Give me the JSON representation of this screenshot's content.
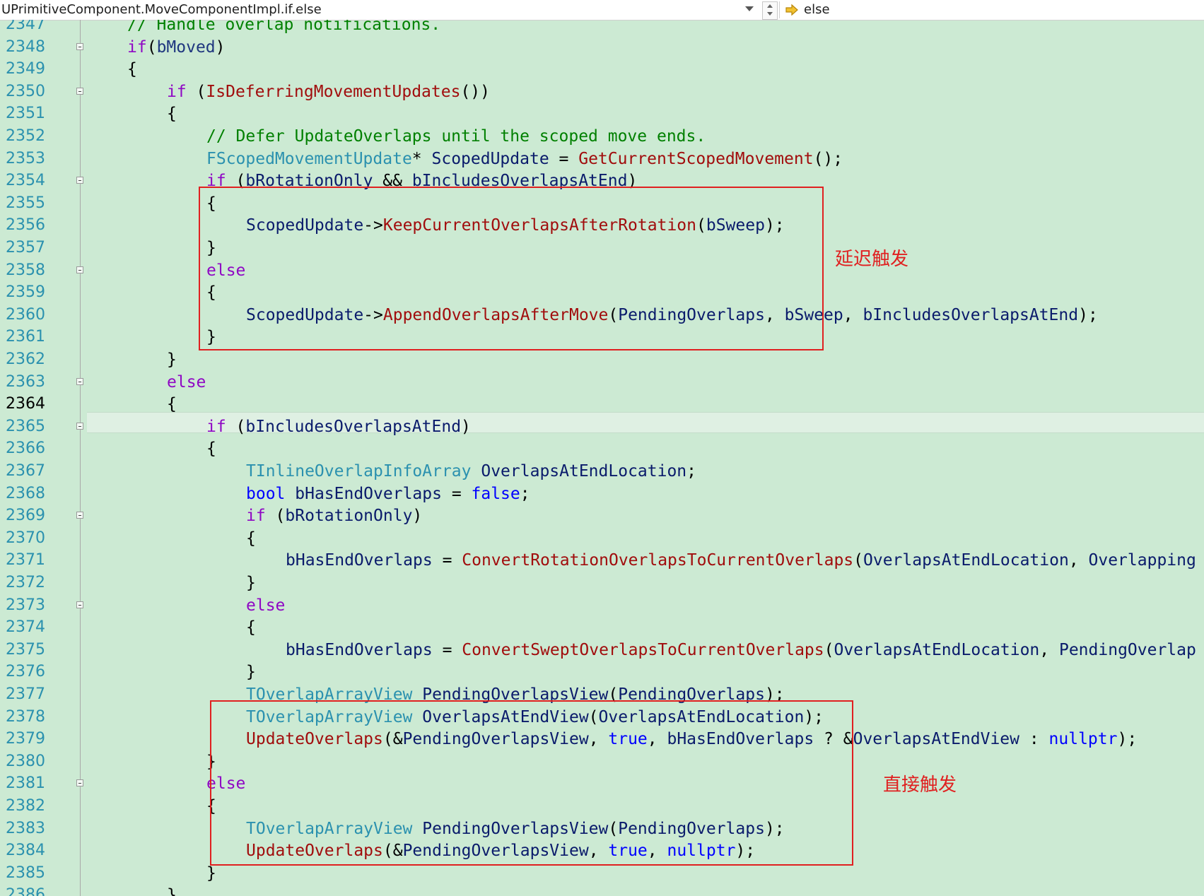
{
  "navbar": {
    "scope": "UPrimitiveComponent.MoveComponentImpl.if.else",
    "member": "else"
  },
  "annotations": {
    "deferred": "延迟触发",
    "direct": "直接触发"
  },
  "lines": [
    {
      "n": "2347",
      "fold": false,
      "indent": 1,
      "tokens": [
        [
          "cm",
          "// Handle overlap notifications."
        ]
      ]
    },
    {
      "n": "2348",
      "fold": true,
      "indent": 1,
      "tokens": [
        [
          "k",
          "if"
        ],
        [
          "",
          "("
        ],
        [
          "v",
          "bMoved"
        ],
        [
          "",
          ")"
        ]
      ]
    },
    {
      "n": "2349",
      "fold": false,
      "indent": 1,
      "tokens": [
        [
          "",
          "{"
        ]
      ]
    },
    {
      "n": "2350",
      "fold": true,
      "indent": 2,
      "tokens": [
        [
          "k",
          "if"
        ],
        [
          "",
          " ("
        ],
        [
          "fc",
          "IsDeferringMovementUpdates"
        ],
        [
          "",
          "())"
        ]
      ]
    },
    {
      "n": "2351",
      "fold": false,
      "indent": 2,
      "tokens": [
        [
          "",
          "{"
        ]
      ]
    },
    {
      "n": "2352",
      "fold": false,
      "indent": 3,
      "tokens": [
        [
          "cm",
          "// Defer UpdateOverlaps until the scoped move ends."
        ]
      ]
    },
    {
      "n": "2353",
      "fold": false,
      "indent": 3,
      "tokens": [
        [
          "t",
          "FScopedMovementUpdate"
        ],
        [
          "",
          "* "
        ],
        [
          "v2",
          "ScopedUpdate"
        ],
        [
          "",
          " = "
        ],
        [
          "fc",
          "GetCurrentScopedMovement"
        ],
        [
          "",
          "();"
        ]
      ]
    },
    {
      "n": "2354",
      "fold": true,
      "indent": 3,
      "tokens": [
        [
          "k",
          "if"
        ],
        [
          "",
          " ("
        ],
        [
          "v2",
          "bRotationOnly"
        ],
        [
          "",
          " && "
        ],
        [
          "v2",
          "bIncludesOverlapsAtEnd"
        ],
        [
          "",
          ")"
        ]
      ]
    },
    {
      "n": "2355",
      "fold": false,
      "indent": 3,
      "tokens": [
        [
          "",
          "{"
        ]
      ]
    },
    {
      "n": "2356",
      "fold": false,
      "indent": 4,
      "tokens": [
        [
          "v2",
          "ScopedUpdate"
        ],
        [
          "",
          "->"
        ],
        [
          "fc",
          "KeepCurrentOverlapsAfterRotation"
        ],
        [
          "",
          "("
        ],
        [
          "v2",
          "bSweep"
        ],
        [
          "",
          ");"
        ]
      ]
    },
    {
      "n": "2357",
      "fold": false,
      "indent": 3,
      "tokens": [
        [
          "",
          "}"
        ]
      ]
    },
    {
      "n": "2358",
      "fold": true,
      "indent": 3,
      "tokens": [
        [
          "k",
          "else"
        ]
      ]
    },
    {
      "n": "2359",
      "fold": false,
      "indent": 3,
      "tokens": [
        [
          "",
          "{"
        ]
      ]
    },
    {
      "n": "2360",
      "fold": false,
      "indent": 4,
      "tokens": [
        [
          "v2",
          "ScopedUpdate"
        ],
        [
          "",
          "->"
        ],
        [
          "fc",
          "AppendOverlapsAfterMove"
        ],
        [
          "",
          "("
        ],
        [
          "v2",
          "PendingOverlaps"
        ],
        [
          "",
          ", "
        ],
        [
          "v2",
          "bSweep"
        ],
        [
          "",
          ", "
        ],
        [
          "v2",
          "bIncludesOverlapsAtEnd"
        ],
        [
          "",
          ");"
        ]
      ]
    },
    {
      "n": "2361",
      "fold": false,
      "indent": 3,
      "tokens": [
        [
          "",
          "}"
        ]
      ]
    },
    {
      "n": "2362",
      "fold": false,
      "indent": 2,
      "tokens": [
        [
          "",
          "}"
        ]
      ]
    },
    {
      "n": "2363",
      "fold": true,
      "indent": 2,
      "tokens": [
        [
          "k",
          "else"
        ]
      ]
    },
    {
      "n": "2364",
      "fold": false,
      "indent": 2,
      "current": true,
      "tokens": [
        [
          "",
          "{"
        ]
      ]
    },
    {
      "n": "2365",
      "fold": true,
      "indent": 3,
      "tokens": [
        [
          "k",
          "if"
        ],
        [
          "",
          " ("
        ],
        [
          "v2",
          "bIncludesOverlapsAtEnd"
        ],
        [
          "",
          ")"
        ]
      ]
    },
    {
      "n": "2366",
      "fold": false,
      "indent": 3,
      "tokens": [
        [
          "",
          "{"
        ]
      ]
    },
    {
      "n": "2367",
      "fold": false,
      "indent": 4,
      "tokens": [
        [
          "t",
          "TInlineOverlapInfoArray"
        ],
        [
          "",
          " "
        ],
        [
          "v2",
          "OverlapsAtEndLocation"
        ],
        [
          "",
          ";"
        ]
      ]
    },
    {
      "n": "2368",
      "fold": false,
      "indent": 4,
      "tokens": [
        [
          "b",
          "bool"
        ],
        [
          "",
          " "
        ],
        [
          "v2",
          "bHasEndOverlaps"
        ],
        [
          "",
          " = "
        ],
        [
          "b",
          "false"
        ],
        [
          "",
          ";"
        ]
      ]
    },
    {
      "n": "2369",
      "fold": true,
      "indent": 4,
      "tokens": [
        [
          "k",
          "if"
        ],
        [
          "",
          " ("
        ],
        [
          "v2",
          "bRotationOnly"
        ],
        [
          "",
          ")"
        ]
      ]
    },
    {
      "n": "2370",
      "fold": false,
      "indent": 4,
      "tokens": [
        [
          "",
          "{"
        ]
      ]
    },
    {
      "n": "2371",
      "fold": false,
      "indent": 5,
      "tokens": [
        [
          "v2",
          "bHasEndOverlaps"
        ],
        [
          "",
          " = "
        ],
        [
          "fc",
          "ConvertRotationOverlapsToCurrentOverlaps"
        ],
        [
          "",
          "("
        ],
        [
          "v2",
          "OverlapsAtEndLocation"
        ],
        [
          "",
          ", "
        ],
        [
          "v2",
          "Overlapping"
        ]
      ]
    },
    {
      "n": "2372",
      "fold": false,
      "indent": 4,
      "tokens": [
        [
          "",
          "}"
        ]
      ]
    },
    {
      "n": "2373",
      "fold": true,
      "indent": 4,
      "tokens": [
        [
          "k",
          "else"
        ]
      ]
    },
    {
      "n": "2374",
      "fold": false,
      "indent": 4,
      "tokens": [
        [
          "",
          "{"
        ]
      ]
    },
    {
      "n": "2375",
      "fold": false,
      "indent": 5,
      "tokens": [
        [
          "v2",
          "bHasEndOverlaps"
        ],
        [
          "",
          " = "
        ],
        [
          "fc",
          "ConvertSweptOverlapsToCurrentOverlaps"
        ],
        [
          "",
          "("
        ],
        [
          "v2",
          "OverlapsAtEndLocation"
        ],
        [
          "",
          ", "
        ],
        [
          "v2",
          "PendingOverlap"
        ]
      ]
    },
    {
      "n": "2376",
      "fold": false,
      "indent": 4,
      "tokens": [
        [
          "",
          "}"
        ]
      ]
    },
    {
      "n": "2377",
      "fold": false,
      "indent": 4,
      "tokens": [
        [
          "t",
          "TOverlapArrayView"
        ],
        [
          "",
          " "
        ],
        [
          "v2",
          "PendingOverlapsView"
        ],
        [
          "",
          "("
        ],
        [
          "v2",
          "PendingOverlaps"
        ],
        [
          "",
          ");"
        ]
      ]
    },
    {
      "n": "2378",
      "fold": false,
      "indent": 4,
      "tokens": [
        [
          "t",
          "TOverlapArrayView"
        ],
        [
          "",
          " "
        ],
        [
          "v2",
          "OverlapsAtEndView"
        ],
        [
          "",
          "("
        ],
        [
          "v2",
          "OverlapsAtEndLocation"
        ],
        [
          "",
          ");"
        ]
      ]
    },
    {
      "n": "2379",
      "fold": false,
      "indent": 4,
      "tokens": [
        [
          "fc",
          "UpdateOverlaps"
        ],
        [
          "",
          "(&"
        ],
        [
          "v2",
          "PendingOverlapsView"
        ],
        [
          "",
          ", "
        ],
        [
          "b",
          "true"
        ],
        [
          "",
          ", "
        ],
        [
          "v2",
          "bHasEndOverlaps"
        ],
        [
          "",
          " ? &"
        ],
        [
          "v2",
          "OverlapsAtEndView"
        ],
        [
          "",
          " : "
        ],
        [
          "b",
          "nullptr"
        ],
        [
          "",
          ");"
        ]
      ]
    },
    {
      "n": "2380",
      "fold": false,
      "indent": 3,
      "tokens": [
        [
          "",
          "}"
        ]
      ]
    },
    {
      "n": "2381",
      "fold": true,
      "indent": 3,
      "tokens": [
        [
          "k",
          "else"
        ]
      ]
    },
    {
      "n": "2382",
      "fold": false,
      "indent": 3,
      "tokens": [
        [
          "",
          "{"
        ]
      ]
    },
    {
      "n": "2383",
      "fold": false,
      "indent": 4,
      "tokens": [
        [
          "t",
          "TOverlapArrayView"
        ],
        [
          "",
          " "
        ],
        [
          "v2",
          "PendingOverlapsView"
        ],
        [
          "",
          "("
        ],
        [
          "v2",
          "PendingOverlaps"
        ],
        [
          "",
          ");"
        ]
      ]
    },
    {
      "n": "2384",
      "fold": false,
      "indent": 4,
      "tokens": [
        [
          "fc",
          "UpdateOverlaps"
        ],
        [
          "",
          "(&"
        ],
        [
          "v2",
          "PendingOverlapsView"
        ],
        [
          "",
          ", "
        ],
        [
          "b",
          "true"
        ],
        [
          "",
          ", "
        ],
        [
          "b",
          "nullptr"
        ],
        [
          "",
          ");"
        ]
      ]
    },
    {
      "n": "2385",
      "fold": false,
      "indent": 3,
      "tokens": [
        [
          "",
          "}"
        ]
      ]
    },
    {
      "n": "2386",
      "fold": false,
      "indent": 2,
      "tokens": [
        [
          "",
          "}"
        ]
      ]
    }
  ]
}
